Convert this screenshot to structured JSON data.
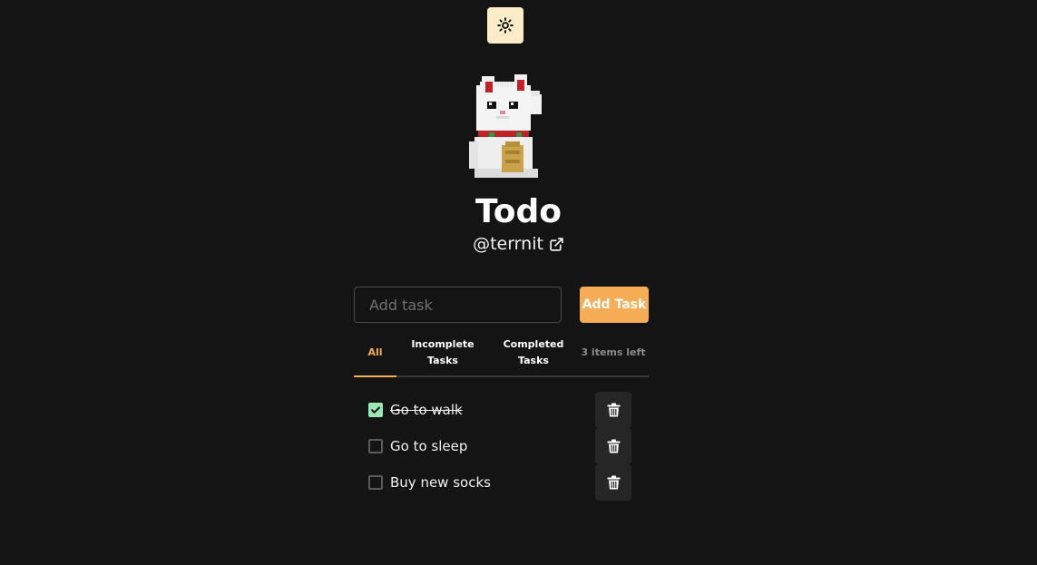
{
  "app": {
    "title": "Todo",
    "handle": "@terrnit"
  },
  "colors": {
    "background": "#141414",
    "accent": "#f6ad55",
    "theme_toggle_bg": "#fdecc8",
    "checkbox_checked": "#9ae6b4"
  },
  "icons": {
    "theme_toggle": "sun-icon",
    "handle_link": "external-link-icon",
    "delete": "trash-icon",
    "checked": "checkmark-icon"
  },
  "add_task": {
    "placeholder": "Add task",
    "value": "",
    "button_label": "Add Task"
  },
  "tabs": [
    {
      "label": "All",
      "active": true
    },
    {
      "label": "Incomplete Tasks",
      "active": false
    },
    {
      "label": "Completed Tasks",
      "active": false
    }
  ],
  "items_left": "3 items left",
  "todos": [
    {
      "text": "Go to walk",
      "completed": true
    },
    {
      "text": "Go to sleep",
      "completed": false
    },
    {
      "text": "Buy new socks",
      "completed": false
    }
  ]
}
